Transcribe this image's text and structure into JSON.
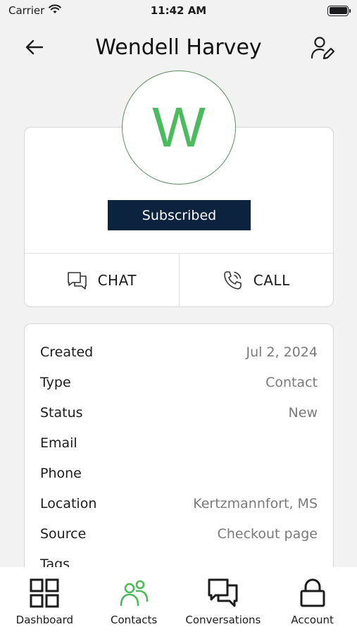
{
  "status_bar": {
    "carrier": "Carrier",
    "time": "11:42 AM"
  },
  "header": {
    "title": "Wendell Harvey"
  },
  "profile": {
    "initial": "W",
    "badge": "Subscribed",
    "actions": {
      "chat": "CHAT",
      "call": "CALL"
    }
  },
  "details": [
    {
      "label": "Created",
      "value": "Jul 2, 2024"
    },
    {
      "label": "Type",
      "value": "Contact"
    },
    {
      "label": "Status",
      "value": "New"
    },
    {
      "label": "Email",
      "value": ""
    },
    {
      "label": "Phone",
      "value": ""
    },
    {
      "label": "Location",
      "value": "Kertzmannfort, MS"
    },
    {
      "label": "Source",
      "value": "Checkout page"
    },
    {
      "label": "Tags",
      "value": ""
    }
  ],
  "tabs": [
    {
      "label": "Dashboard",
      "icon": "grid-icon"
    },
    {
      "label": "Contacts",
      "icon": "people-icon",
      "active": true
    },
    {
      "label": "Conversations",
      "icon": "chat-icon"
    },
    {
      "label": "Account",
      "icon": "lock-icon"
    }
  ],
  "colors": {
    "accent": "#4cbb5e",
    "badge_bg": "#0c2340"
  }
}
